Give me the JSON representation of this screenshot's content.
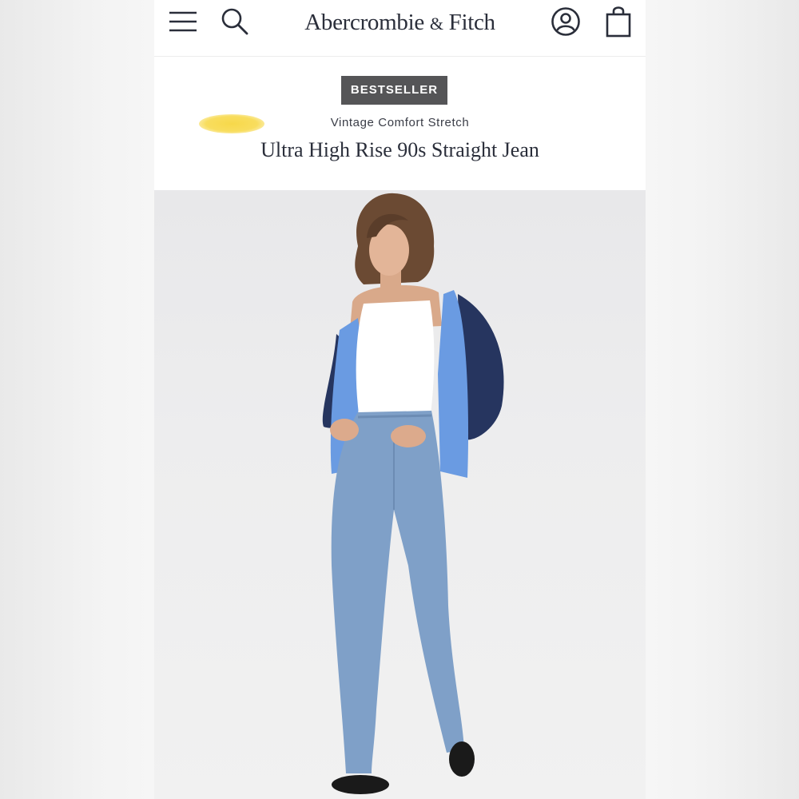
{
  "header": {
    "brand": "Abercrombie",
    "brand_amp": "&",
    "brand_tail": "Fitch",
    "icons": [
      "menu-icon",
      "search-icon",
      "account-icon",
      "bag-icon"
    ]
  },
  "product": {
    "badge": "BESTSELLER",
    "collection": "Vintage Comfort Stretch",
    "title": "Ultra High Rise 90s Straight Jean"
  },
  "colors": {
    "badge_bg": "#555557",
    "text_dark": "#2a2e3a",
    "highlight": "#f7d84a",
    "jeans": "#7fa0c8",
    "jacket": "#26355f",
    "shirt": "#6a9be2"
  }
}
